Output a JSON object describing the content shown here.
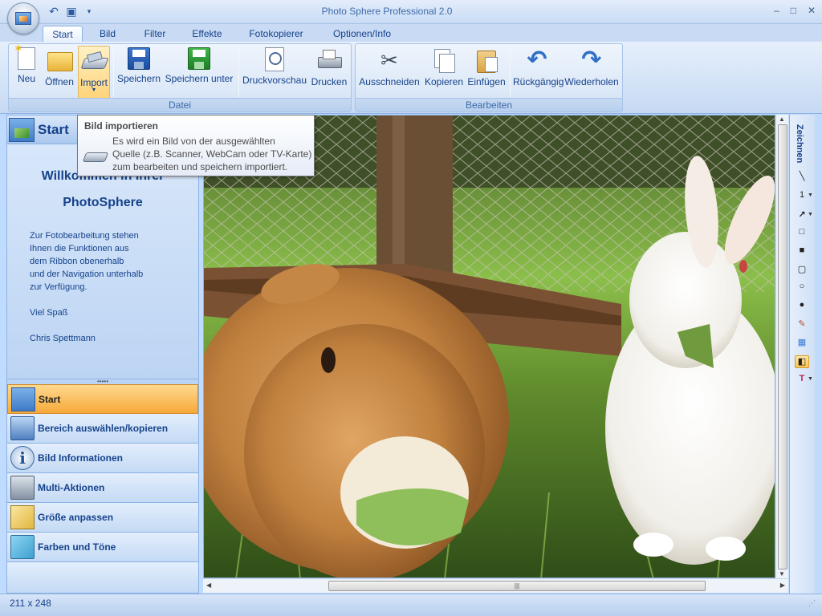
{
  "window": {
    "title": "Photo Sphere Professional 2.0",
    "controls": [
      "–",
      "□",
      "✕"
    ]
  },
  "tabs": [
    {
      "label": "Start",
      "active": true
    },
    {
      "label": "Bild"
    },
    {
      "label": "Filter"
    },
    {
      "label": "Effekte"
    },
    {
      "label": "Fotokopierer"
    },
    {
      "label": "Optionen/Info"
    }
  ],
  "ribbon": {
    "groups": [
      {
        "label": "Datei",
        "buttons": [
          {
            "label": "Neu",
            "icon": "new-file-icon"
          },
          {
            "label": "Öffnen",
            "icon": "folder-open-icon"
          },
          {
            "label": "Import",
            "icon": "scanner-icon",
            "hovered": true,
            "has_dropdown": true
          },
          {
            "label": "Speichern",
            "icon": "save-icon"
          },
          {
            "label": "Speichern unter",
            "icon": "save-as-icon"
          },
          {
            "label": "Druckvorschau",
            "icon": "print-preview-icon"
          },
          {
            "label": "Drucken",
            "icon": "printer-icon"
          }
        ]
      },
      {
        "label": "Bearbeiten",
        "buttons": [
          {
            "label": "Ausschneiden",
            "icon": "scissors-icon"
          },
          {
            "label": "Kopieren",
            "icon": "copy-icon"
          },
          {
            "label": "Einfügen",
            "icon": "paste-icon"
          },
          {
            "label": "Rückgängig",
            "icon": "undo-icon"
          },
          {
            "label": "Wiederholen",
            "icon": "redo-icon"
          }
        ]
      }
    ]
  },
  "tooltip": {
    "title": "Bild importieren",
    "line1": "Es wird ein Bild von der ausgewählten",
    "line2": "Quelle (z.B. Scanner, WebCam oder TV-Karte)",
    "line3": "zum bearbeiten und speichern importiert."
  },
  "left_pane": {
    "header": "Start",
    "welcome_line1": "Willkommen in Ihrer",
    "welcome_line2": "PhotoSphere",
    "body": "Zur Fotobearbeitung stehen\nIhnen die Funktionen aus\ndem Ribbon obenerhalb\nund der Navigation unterhalb\nzur Verfügung.\n\nViel Spaß\n\nChris Spettmann",
    "nav": [
      {
        "label": "Start",
        "icon": "picture-icon",
        "active": true
      },
      {
        "label": "Bereich auswählen/kopieren",
        "icon": "monitor-icon"
      },
      {
        "label": "Bild Informationen",
        "icon": "info-icon"
      },
      {
        "label": "Multi-Aktionen",
        "icon": "multi-images-icon"
      },
      {
        "label": "Größe anpassen",
        "icon": "ruler-icon"
      },
      {
        "label": "Farben und Töne",
        "icon": "color-tools-icon"
      }
    ]
  },
  "right_toolbar": {
    "title": "Zeichnen",
    "line_width": "1"
  },
  "status": {
    "text": "211 x 248"
  }
}
